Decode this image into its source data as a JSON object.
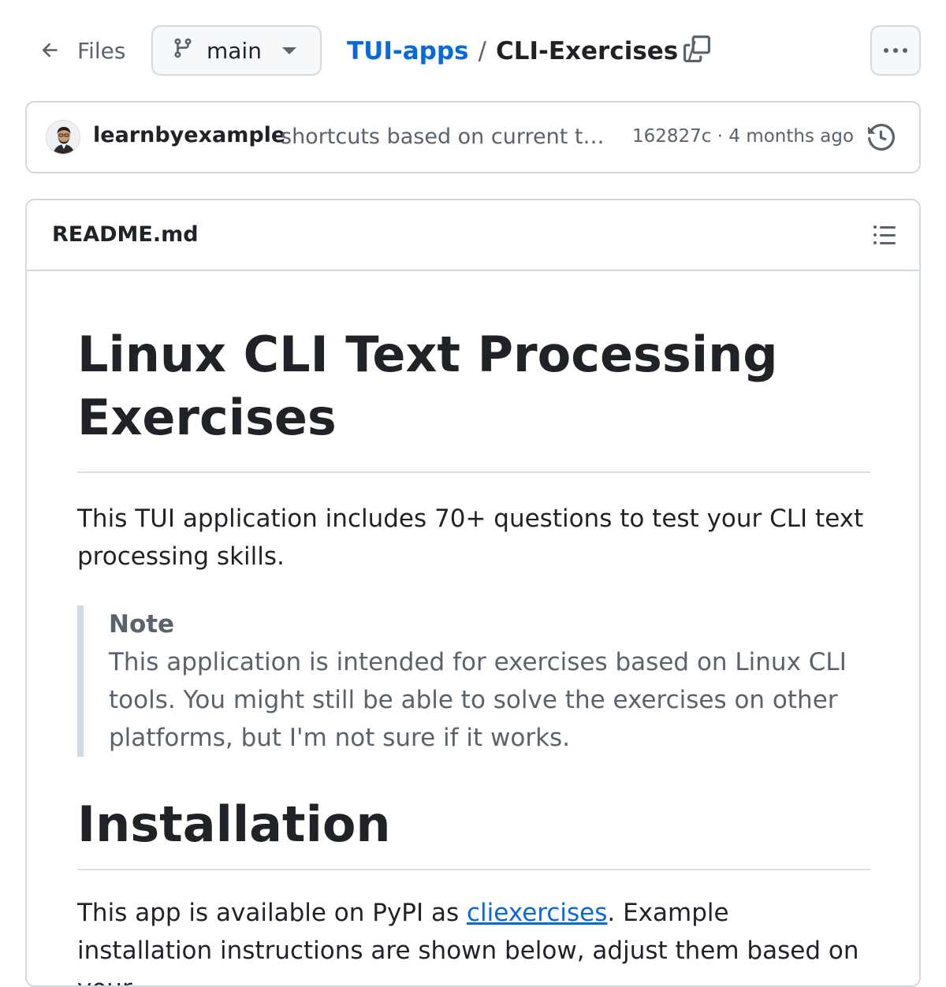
{
  "header": {
    "files_label": "Files",
    "branch_name": "main",
    "breadcrumb": {
      "repo": "TUI-apps",
      "separator": "/",
      "folder": "CLI-Exercises",
      "trailing_separator": "/"
    }
  },
  "commit": {
    "author": "learnbyexample",
    "message": "shortcuts based on current tab, minor changes",
    "sha": "162827c",
    "meta_separator": " · ",
    "age": "4 months ago"
  },
  "readme": {
    "filename": "README.md",
    "title": "Linux CLI Text Processing Exercises",
    "intro": "This TUI application includes 70+ questions to test your CLI text processing skills.",
    "note": {
      "title": "Note",
      "text": "This application is intended for exercises based on Linux CLI tools. You might still be able to solve the exercises on other platforms, but I'm not sure if it works."
    },
    "section_title": "Installation",
    "install_text_before": "This app is available on PyPI as ",
    "install_link": "cliexercises",
    "install_text_after": ". Example installation instructions are shown below, adjust them based on your"
  },
  "colors": {
    "link": "#0969da",
    "muted": "#59636e",
    "text": "#1f2328",
    "border": "#d1d9e0"
  },
  "icons": [
    "arrow-left-icon",
    "git-branch-icon",
    "caret-down-icon",
    "copy-icon",
    "kebab-icon",
    "history-icon",
    "list-icon"
  ]
}
